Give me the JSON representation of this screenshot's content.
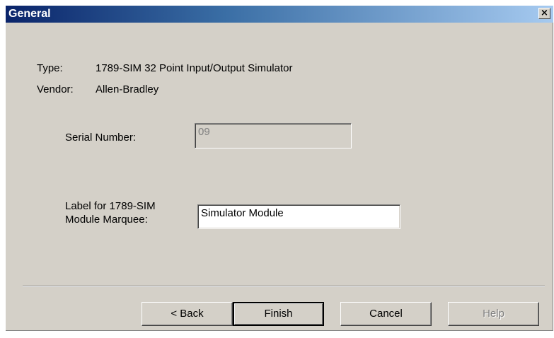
{
  "window": {
    "title": "General",
    "close_glyph": "×"
  },
  "info": {
    "type_label": "Type:",
    "type_value": "1789-SIM 32 Point Input/Output Simulator",
    "vendor_label": "Vendor:",
    "vendor_value": "Allen-Bradley"
  },
  "serial": {
    "label": "Serial Number:",
    "value": "09"
  },
  "marquee": {
    "label_line1": "Label for 1789-SIM",
    "label_line2": "Module Marquee:",
    "value": "Simulator Module"
  },
  "buttons": {
    "back": "< Back",
    "finish": "Finish",
    "cancel": "Cancel",
    "help": "Help"
  }
}
